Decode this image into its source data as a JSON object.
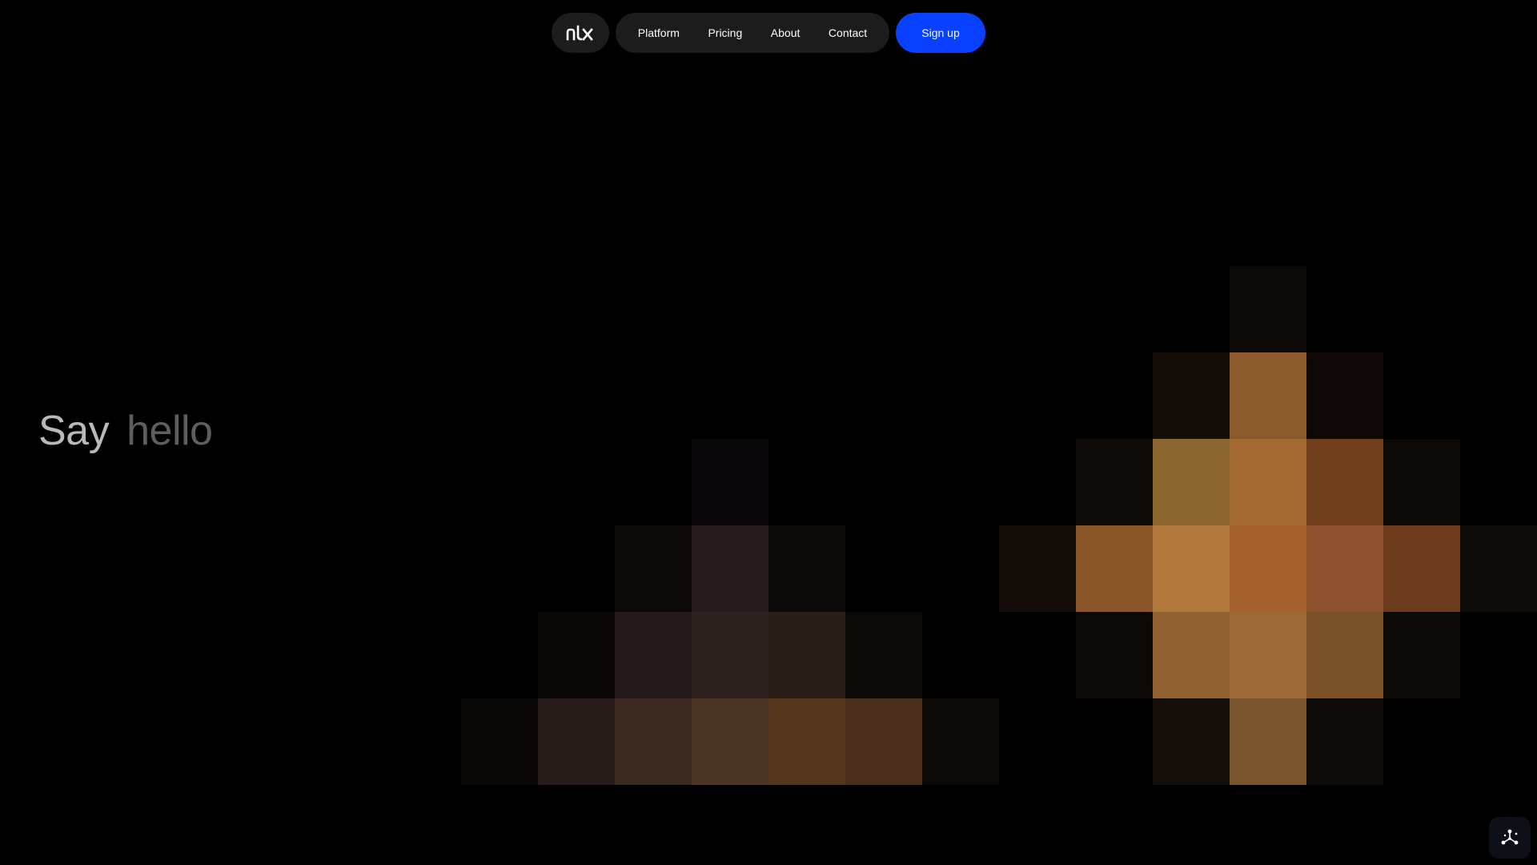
{
  "nav": {
    "logo_text": "nlx",
    "links": [
      "Platform",
      "Pricing",
      "About",
      "Contact"
    ],
    "signup_label": "Sign up",
    "signup_color": "#0a40ff"
  },
  "hero": {
    "word1": "Say",
    "word2": "hello"
  },
  "widget": {
    "icon": "sparkle-network-icon"
  }
}
